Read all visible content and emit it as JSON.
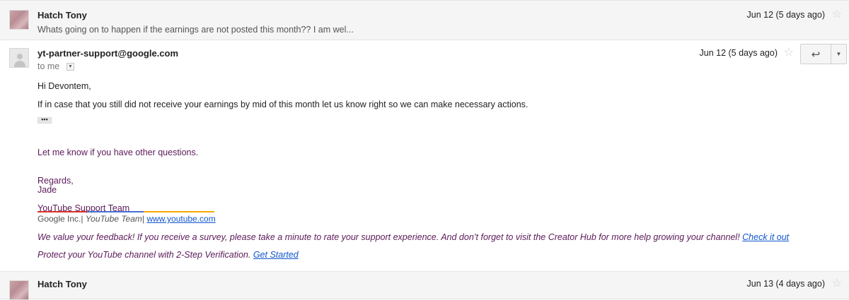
{
  "thread": {
    "top_message": {
      "sender": "Hatch Tony",
      "snippet": "Whats going on to happen if the earnings are not posted this month?? I am wel...",
      "date": "Jun 12 (5 days ago)"
    },
    "open_message": {
      "sender": "yt-partner-support@google.com",
      "to": "to me",
      "date": "Jun 12 (5 days ago)",
      "greeting": "Hi Devontem,",
      "paragraph1": "If in case that you still did not receive your earnings by mid of this month let us know right so we can make necessary actions.",
      "ellipsis": "•••",
      "questions": "Let me know if you have other questions.",
      "regards": "Regards,",
      "name": "Jade",
      "team": "YouTube Support Team",
      "company": "Google Inc.",
      "company_team": "YouTube Team",
      "website": "www.youtube.com",
      "feedback": "We value your feedback! If you receive a survey, please take a minute to rate your support experience. And don’t forget to visit the Creator Hub for more help growing your channel!",
      "feedback_link": "Check it out",
      "protect": "Protect your YouTube channel with 2-Step Verification.",
      "protect_link": "Get Started"
    },
    "bottom_message": {
      "sender": "Hatch Tony",
      "date": "Jun 13 (4 days ago)"
    }
  },
  "icons": {
    "star": "☆",
    "reply": "↩",
    "more": "▼",
    "dropdown": "▼"
  },
  "colors": {
    "signature_purple": "#5b1a59",
    "link_blue": "#1155cc",
    "sig_red": "#d93025",
    "sig_blue": "#4a6fd3",
    "sig_yellow": "#f2a900"
  }
}
